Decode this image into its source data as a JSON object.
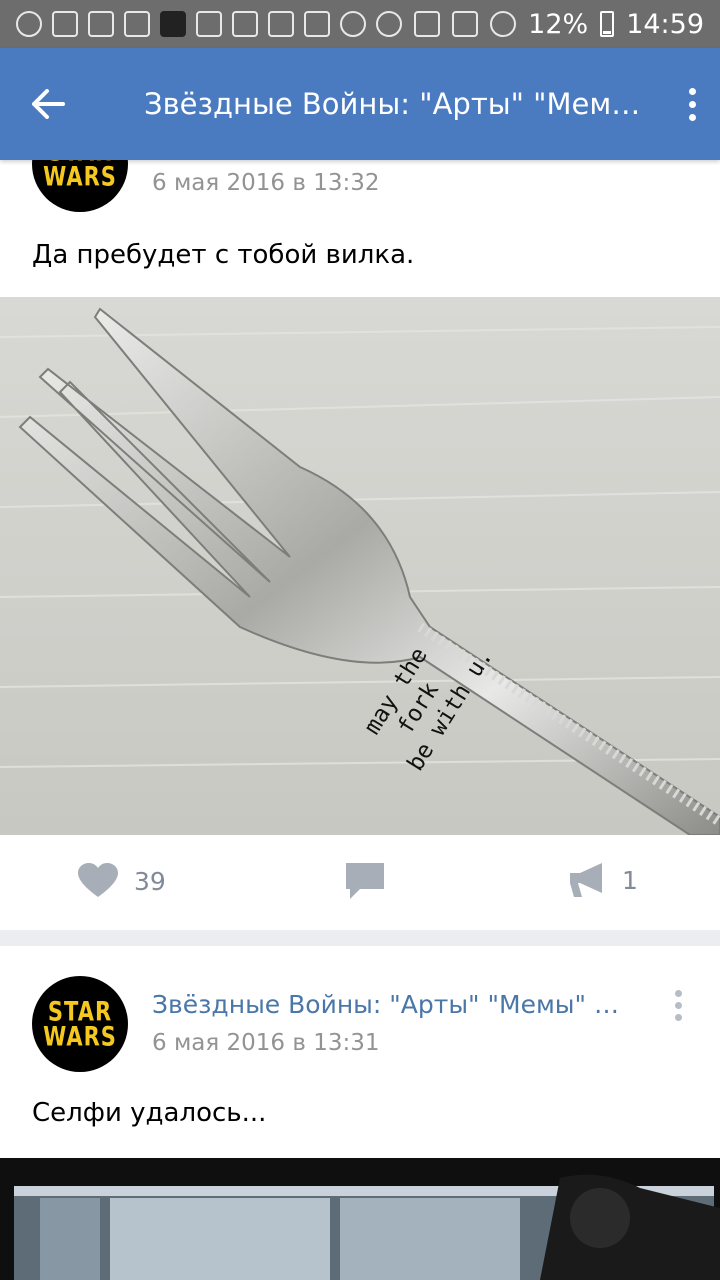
{
  "status_bar": {
    "battery": "12%",
    "time": "14:59"
  },
  "app_bar": {
    "title": "Звёздные Войны: \"Арты\" \"Мемы\" и много другого"
  },
  "post1": {
    "date": "6 мая 2016 в 13:32",
    "text": "Да пребудет с тобой вилка.",
    "avatar_text": "STAR WARS",
    "photo_text": [
      "may the",
      "fork",
      "be with u."
    ],
    "likes": "39",
    "shares": "1"
  },
  "post2": {
    "author": "Звёздные Войны: \"Арты\" \"Мемы\" и много другого",
    "date": "6 мая 2016 в 13:31",
    "text": "Селфи удалось...",
    "avatar_text": "STAR WARS"
  },
  "icons": {
    "back": "back-arrow-icon",
    "menu": "more-vertical-icon",
    "like": "heart-icon",
    "comment": "comment-icon",
    "share": "megaphone-icon"
  }
}
